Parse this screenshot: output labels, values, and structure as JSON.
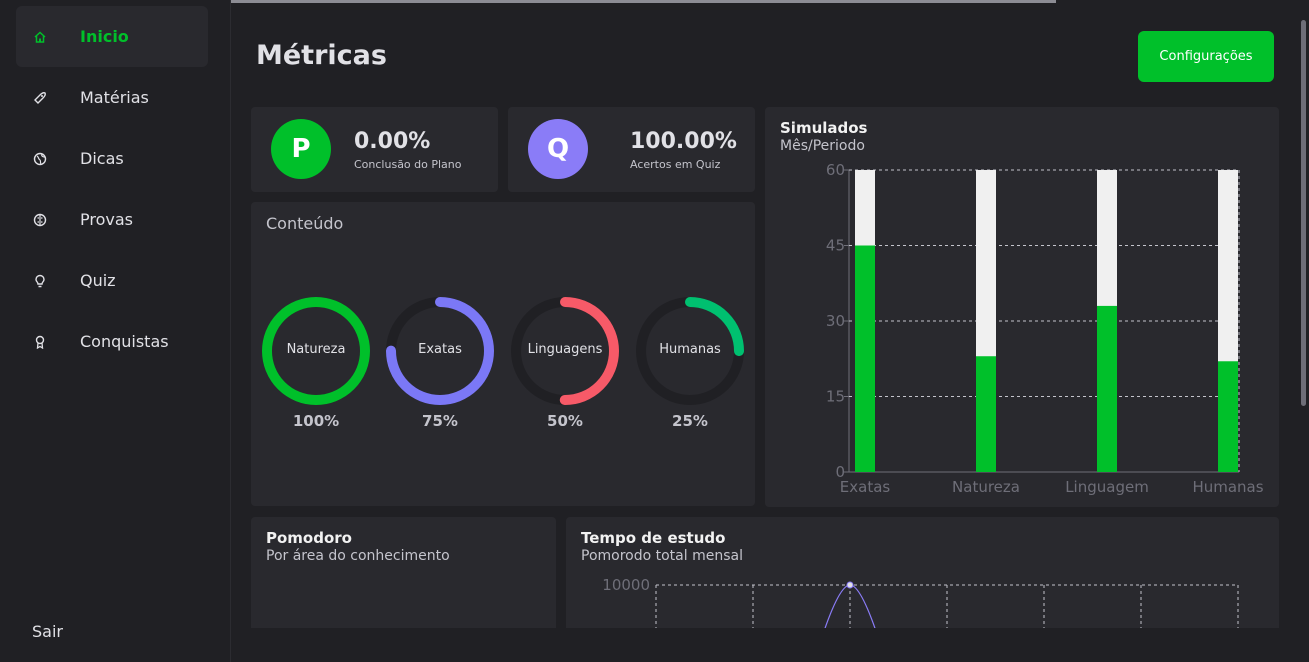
{
  "sidebar": {
    "items": [
      {
        "label": "Inicio",
        "icon": "home-icon"
      },
      {
        "label": "Matérias",
        "icon": "rocket-icon"
      },
      {
        "label": "Dicas",
        "icon": "globe-icon"
      },
      {
        "label": "Provas",
        "icon": "brain-icon"
      },
      {
        "label": "Quiz",
        "icon": "bulb-icon"
      },
      {
        "label": "Conquistas",
        "icon": "medal-icon"
      }
    ],
    "logout_label": "Sair"
  },
  "header": {
    "title": "Métricas",
    "config_label": "Configurações"
  },
  "stats": [
    {
      "letter": "P",
      "value": "0.00%",
      "label": "Conclusão do Plano",
      "color": "#00c02a"
    },
    {
      "letter": "Q",
      "value": "100.00%",
      "label": "Acertos em Quiz",
      "color": "#8257e5"
    }
  ],
  "content": {
    "title": "Conteúdo",
    "rings": [
      {
        "label": "Natureza",
        "pct_text": "100%",
        "fraction": 1.0,
        "color": "#00c02a"
      },
      {
        "label": "Exatas",
        "pct_text": "75%",
        "fraction": 0.75,
        "color": "#7b78f6"
      },
      {
        "label": "Linguagens",
        "pct_text": "50%",
        "fraction": 0.5,
        "color": "#f75a68"
      },
      {
        "label": "Humanas",
        "pct_text": "25%",
        "fraction": 0.25,
        "color": "#00c070"
      }
    ]
  },
  "simulados": {
    "title": "Simulados",
    "subtitle": "Mês/Periodo"
  },
  "pomodoro": {
    "title": "Pomodoro",
    "subtitle": "Por área do conhecimento"
  },
  "tempo": {
    "title": "Tempo de estudo",
    "subtitle": "Pomorodo total mensal",
    "ytick": "10000"
  },
  "colors": {
    "accent": "#00c02a",
    "bar_track": "#f0f0f0"
  },
  "chart_data": [
    {
      "type": "bar",
      "title": "Simulados",
      "subtitle": "Mês/Periodo",
      "categories": [
        "Exatas",
        "Natureza",
        "Linguagem",
        "Humanas"
      ],
      "values": [
        45,
        23,
        33,
        22
      ],
      "max_track": 60,
      "ylim": [
        0,
        60
      ],
      "yticks": [
        0,
        15,
        30,
        45,
        60
      ],
      "grid": true
    },
    {
      "type": "line",
      "title": "Tempo de estudo",
      "subtitle": "Pomorodo total mensal",
      "yticks": [
        10000
      ],
      "peak": 10000,
      "grid": true
    }
  ]
}
